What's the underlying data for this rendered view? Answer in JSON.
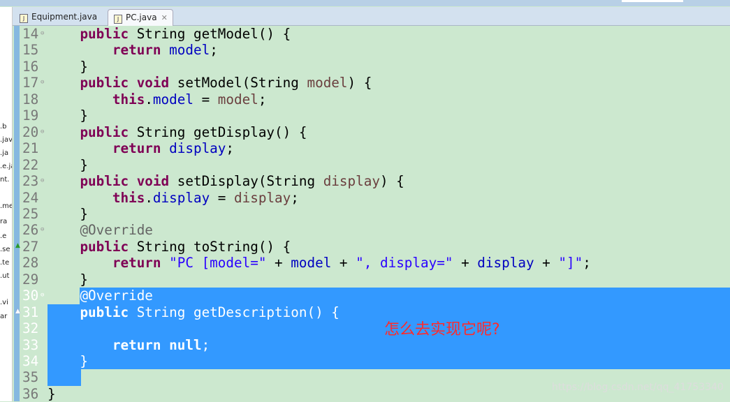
{
  "tabs": [
    {
      "label": "Equipment.java",
      "active": false
    },
    {
      "label": "PC.java",
      "active": true,
      "close": "✕"
    }
  ],
  "explorer_fragments": [
    ".b",
    ".jav",
    ".ja",
    ".e.ja",
    "nt.",
    ".me",
    "ra",
    ".e",
    ".se",
    ".te",
    ".ut",
    ".vi",
    "ar"
  ],
  "colors": {
    "keyword": "#7f0055",
    "field": "#0000c0",
    "param": "#6a3e3e",
    "string": "#2a00ff",
    "annotation": "#646464",
    "selection": "#3399ff",
    "background": "#cce8cf"
  },
  "lines": [
    {
      "n": "14",
      "fold": true,
      "t": [
        [
          "plain",
          "    "
        ],
        [
          "kw",
          "public"
        ],
        [
          "plain",
          " String getModel() {"
        ]
      ]
    },
    {
      "n": "15",
      "t": [
        [
          "plain",
          "        "
        ],
        [
          "kw",
          "return"
        ],
        [
          "plain",
          " "
        ],
        [
          "field",
          "model"
        ],
        [
          "plain",
          ";"
        ]
      ]
    },
    {
      "n": "16",
      "t": [
        [
          "plain",
          "    }"
        ]
      ]
    },
    {
      "n": "17",
      "fold": true,
      "t": [
        [
          "plain",
          "    "
        ],
        [
          "kw",
          "public"
        ],
        [
          "plain",
          " "
        ],
        [
          "kw",
          "void"
        ],
        [
          "plain",
          " setModel(String "
        ],
        [
          "param",
          "model"
        ],
        [
          "plain",
          ") {"
        ]
      ]
    },
    {
      "n": "18",
      "t": [
        [
          "plain",
          "        "
        ],
        [
          "kw",
          "this"
        ],
        [
          "plain",
          "."
        ],
        [
          "field",
          "model"
        ],
        [
          "plain",
          " = "
        ],
        [
          "param",
          "model"
        ],
        [
          "plain",
          ";"
        ]
      ]
    },
    {
      "n": "19",
      "t": [
        [
          "plain",
          "    }"
        ]
      ]
    },
    {
      "n": "20",
      "fold": true,
      "t": [
        [
          "plain",
          "    "
        ],
        [
          "kw",
          "public"
        ],
        [
          "plain",
          " String getDisplay() {"
        ]
      ]
    },
    {
      "n": "21",
      "t": [
        [
          "plain",
          "        "
        ],
        [
          "kw",
          "return"
        ],
        [
          "plain",
          " "
        ],
        [
          "field",
          "display"
        ],
        [
          "plain",
          ";"
        ]
      ]
    },
    {
      "n": "22",
      "t": [
        [
          "plain",
          "    }"
        ]
      ]
    },
    {
      "n": "23",
      "fold": true,
      "t": [
        [
          "plain",
          "    "
        ],
        [
          "kw",
          "public"
        ],
        [
          "plain",
          " "
        ],
        [
          "kw",
          "void"
        ],
        [
          "plain",
          " setDisplay(String "
        ],
        [
          "param",
          "display"
        ],
        [
          "plain",
          ") {"
        ]
      ]
    },
    {
      "n": "24",
      "t": [
        [
          "plain",
          "        "
        ],
        [
          "kw",
          "this"
        ],
        [
          "plain",
          "."
        ],
        [
          "field",
          "display"
        ],
        [
          "plain",
          " = "
        ],
        [
          "param",
          "display"
        ],
        [
          "plain",
          ";"
        ]
      ]
    },
    {
      "n": "25",
      "t": [
        [
          "plain",
          "    }"
        ]
      ]
    },
    {
      "n": "26",
      "fold": true,
      "t": [
        [
          "plain",
          "    "
        ],
        [
          "ann",
          "@Override"
        ]
      ]
    },
    {
      "n": "27",
      "mark": "override",
      "t": [
        [
          "plain",
          "    "
        ],
        [
          "kw",
          "public"
        ],
        [
          "plain",
          " String toString() {"
        ]
      ]
    },
    {
      "n": "28",
      "t": [
        [
          "plain",
          "        "
        ],
        [
          "kw",
          "return"
        ],
        [
          "plain",
          " "
        ],
        [
          "str",
          "\"PC [model=\""
        ],
        [
          "plain",
          " + "
        ],
        [
          "field",
          "model"
        ],
        [
          "plain",
          " + "
        ],
        [
          "str",
          "\", display=\""
        ],
        [
          "plain",
          " + "
        ],
        [
          "field",
          "display"
        ],
        [
          "plain",
          " + "
        ],
        [
          "str",
          "\"]\""
        ],
        [
          "plain",
          ";"
        ]
      ]
    },
    {
      "n": "29",
      "t": [
        [
          "plain",
          "    }"
        ]
      ]
    },
    {
      "n": "30",
      "fold": true,
      "sel": "partial",
      "t": [
        [
          "plain",
          "    "
        ],
        [
          "ann",
          "@Override"
        ]
      ]
    },
    {
      "n": "31",
      "mark": "implement",
      "sel": "full",
      "t": [
        [
          "plain",
          "    "
        ],
        [
          "kw",
          "public"
        ],
        [
          "plain",
          " String getDescription() {"
        ]
      ]
    },
    {
      "n": "32",
      "sel": "full",
      "t": []
    },
    {
      "n": "33",
      "sel": "full",
      "t": [
        [
          "plain",
          "        "
        ],
        [
          "kw",
          "return"
        ],
        [
          "plain",
          " "
        ],
        [
          "kw",
          "null"
        ],
        [
          "plain",
          ";"
        ]
      ]
    },
    {
      "n": "34",
      "sel": "full",
      "t": [
        [
          "plain",
          "    }"
        ]
      ]
    },
    {
      "n": "35",
      "sel": "cursor",
      "t": []
    },
    {
      "n": "36",
      "t": [
        [
          "plain",
          "}"
        ]
      ]
    }
  ],
  "annotation_note": "怎么去实现它呢?",
  "watermark": "https://blog.csdn.net/qq_41753340"
}
